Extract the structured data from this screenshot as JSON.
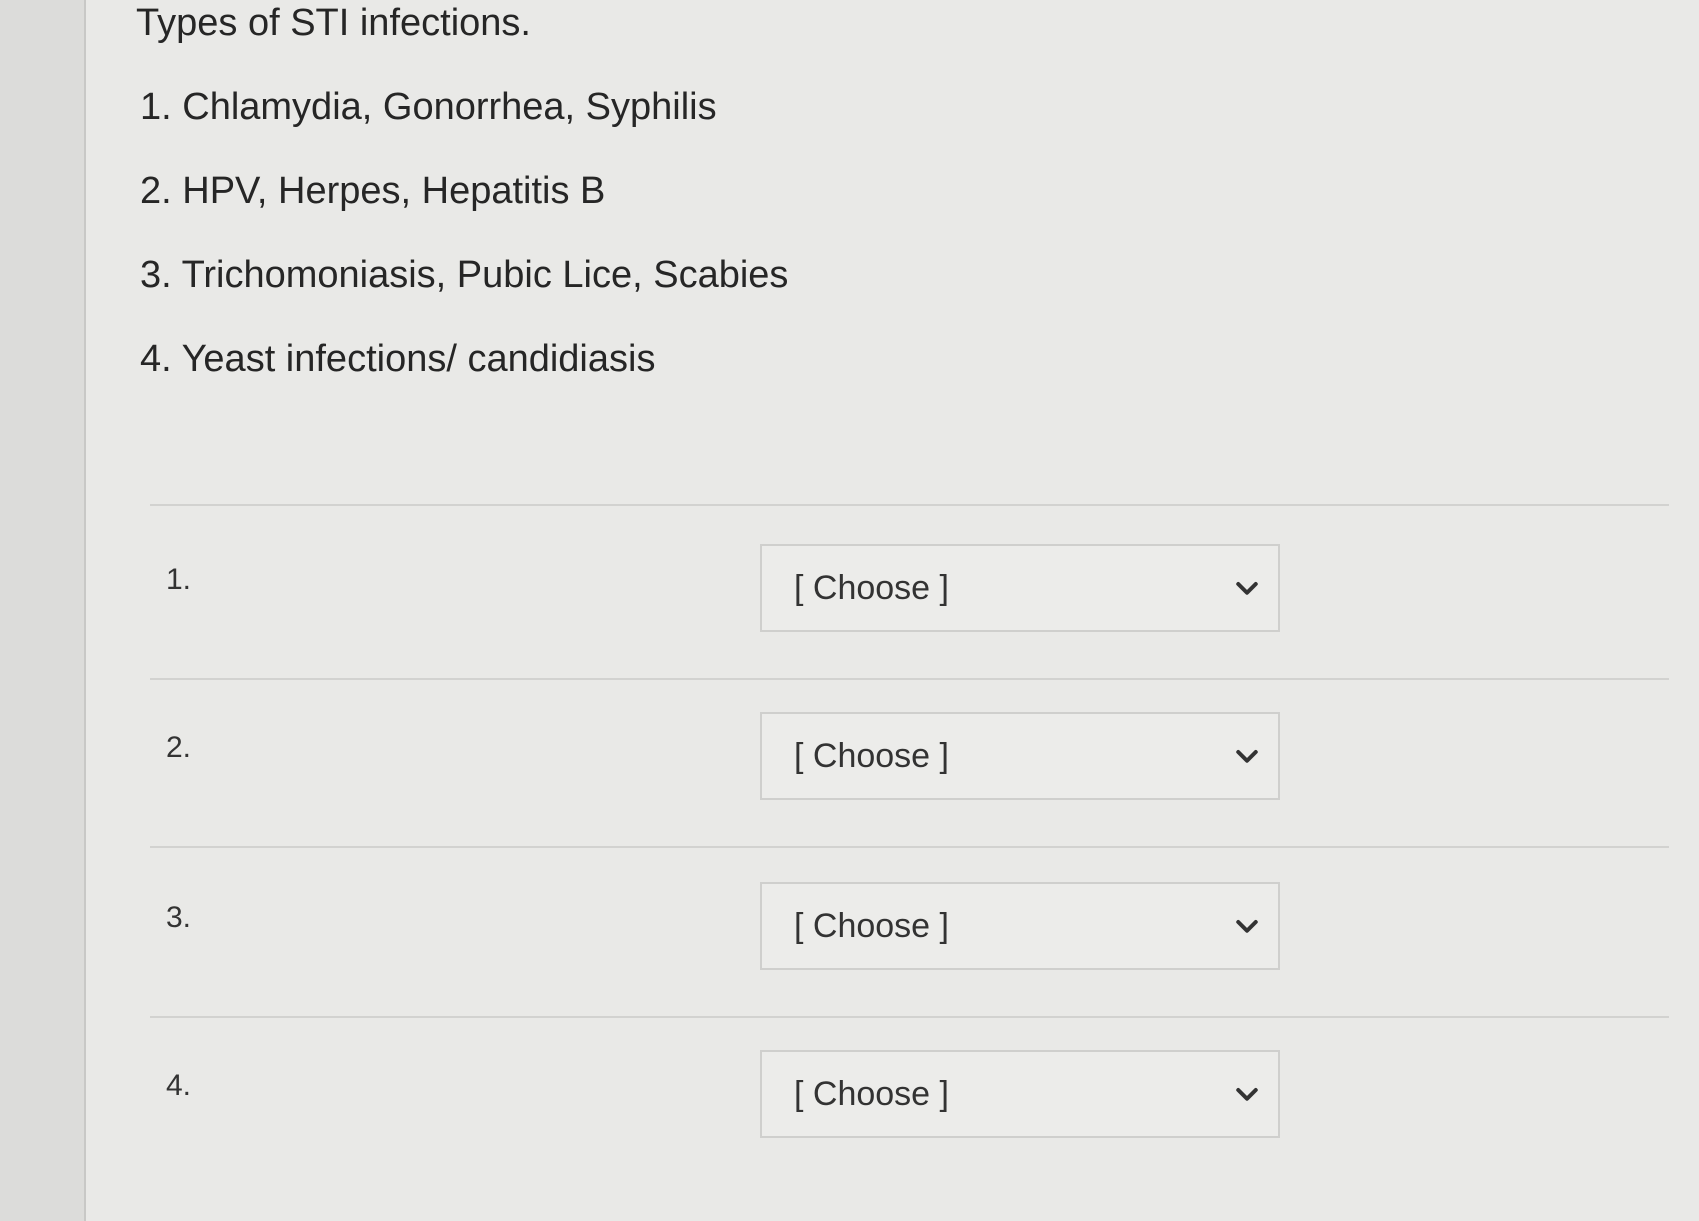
{
  "question": {
    "title": "Types of STI infections.",
    "options": [
      "1. Chlamydia, Gonorrhea, Syphilis",
      "2. HPV, Herpes, Hepatitis B",
      "3. Trichomoniasis, Pubic Lice, Scabies",
      "4. Yeast infections/ candidiasis"
    ]
  },
  "matching": {
    "rows": [
      {
        "label": "1.",
        "selected": "[ Choose ]"
      },
      {
        "label": "2.",
        "selected": "[ Choose ]"
      },
      {
        "label": "3.",
        "selected": "[ Choose ]"
      },
      {
        "label": "4.",
        "selected": "[ Choose ]"
      }
    ],
    "dropdown_icon": "chevron-down-icon"
  },
  "colors": {
    "background": "#e9e9e7",
    "text": "#262626",
    "border": "#cfcfcd"
  }
}
